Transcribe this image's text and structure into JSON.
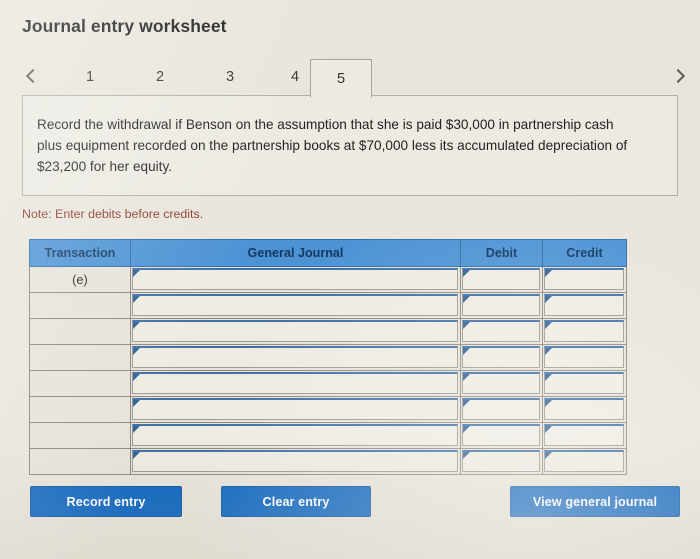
{
  "header": {
    "title": "Journal entry worksheet"
  },
  "tabs": {
    "prev_icon": "chevron-left-icon",
    "next_icon": "chevron-right-icon",
    "items": [
      {
        "label": "1",
        "active": false
      },
      {
        "label": "2",
        "active": false
      },
      {
        "label": "3",
        "active": false
      },
      {
        "label": "4",
        "active": false
      },
      {
        "label": "5",
        "active": true
      }
    ]
  },
  "instruction": {
    "text": "Record the withdrawal if Benson on the assumption that she is paid $30,000 in partnership cash plus equipment recorded on the partnership books at $70,000 less its accumulated depreciation of $23,200 for her equity."
  },
  "note": {
    "text": "Note: Enter debits before credits."
  },
  "table": {
    "columns": [
      "Transaction",
      "General Journal",
      "Debit",
      "Credit"
    ],
    "rows": [
      {
        "transaction": "(e)",
        "general_journal": "",
        "debit": "",
        "credit": ""
      },
      {
        "transaction": "",
        "general_journal": "",
        "debit": "",
        "credit": ""
      },
      {
        "transaction": "",
        "general_journal": "",
        "debit": "",
        "credit": ""
      },
      {
        "transaction": "",
        "general_journal": "",
        "debit": "",
        "credit": ""
      },
      {
        "transaction": "",
        "general_journal": "",
        "debit": "",
        "credit": ""
      },
      {
        "transaction": "",
        "general_journal": "",
        "debit": "",
        "credit": ""
      },
      {
        "transaction": "",
        "general_journal": "",
        "debit": "",
        "credit": ""
      },
      {
        "transaction": "",
        "general_journal": "",
        "debit": "",
        "credit": ""
      }
    ]
  },
  "actions": {
    "record_entry": "Record entry",
    "clear_entry": "Clear entry",
    "view_general_journal": "View general journal"
  },
  "colors": {
    "page_background": "#e9e5dc",
    "panel_background": "#eceae2",
    "table_header": "#4d93d4",
    "table_header_text": "#123a63",
    "button_blue": "#1068c2",
    "note_text": "#8a3a2c",
    "field_accent": "#3d6fa8"
  }
}
